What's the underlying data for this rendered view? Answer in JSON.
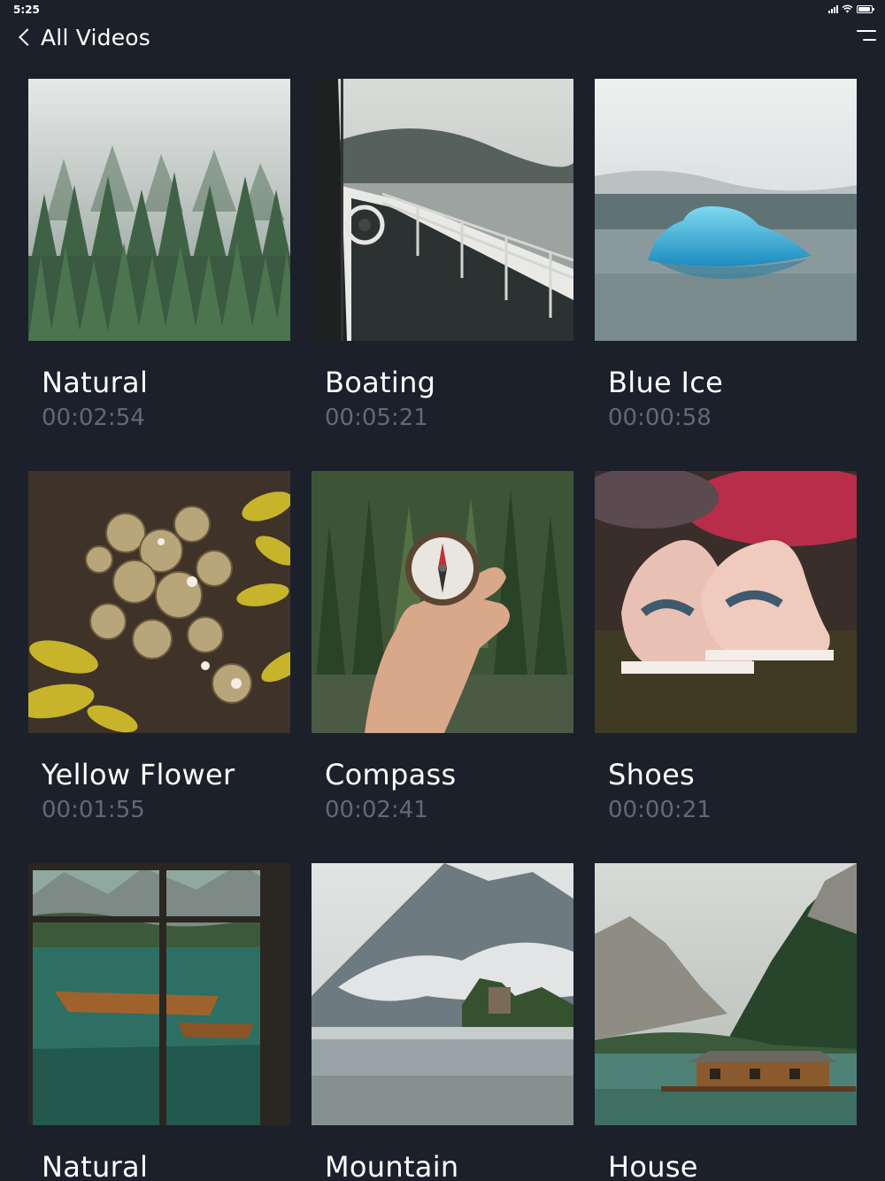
{
  "status_bar": {
    "time": "5:25"
  },
  "nav": {
    "back_icon": "chevron-left-icon",
    "title": "All Videos",
    "menu_icon": "menu-icon"
  },
  "colors": {
    "background": "#1c202b",
    "title_text": "#ffffff",
    "duration_text": "#636875"
  },
  "videos": [
    {
      "title": "Natural",
      "duration": "00:02:54",
      "thumbnail": "misty-pine-forest"
    },
    {
      "title": "Boating",
      "duration": "00:05:21",
      "thumbnail": "ship-deck-railing-lake"
    },
    {
      "title": "Blue Ice",
      "duration": "00:00:58",
      "thumbnail": "blue-iceberg-on-lake"
    },
    {
      "title": "Yellow Flower",
      "duration": "00:01:55",
      "thumbnail": "barnacles-and-yellow-seaweed"
    },
    {
      "title": "Compass",
      "duration": "00:02:41",
      "thumbnail": "hand-holding-compass-forest"
    },
    {
      "title": "Shoes",
      "duration": "00:00:21",
      "thumbnail": "pink-sneakers-on-grass"
    },
    {
      "title": "Natural",
      "duration": "",
      "thumbnail": "lake-boats-through-window"
    },
    {
      "title": "Mountain",
      "duration": "",
      "thumbnail": "misty-mountain-lake-castle"
    },
    {
      "title": "House",
      "duration": "",
      "thumbnail": "boathouse-mountain-lake"
    }
  ]
}
